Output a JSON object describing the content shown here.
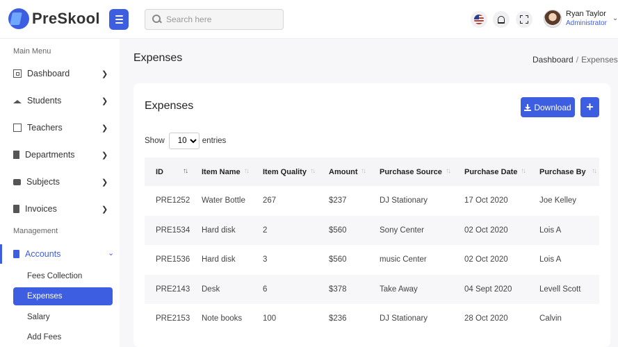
{
  "brand": {
    "name": "PreSkool"
  },
  "search": {
    "placeholder": "Search here"
  },
  "user": {
    "name": "Ryan Taylor",
    "role": "Administrator"
  },
  "sidebar": {
    "main_title": "Main Menu",
    "main_items": [
      {
        "label": "Dashboard",
        "icon": "dashboard-icon"
      },
      {
        "label": "Students",
        "icon": "graduation-cap-icon"
      },
      {
        "label": "Teachers",
        "icon": "teacher-board-icon"
      },
      {
        "label": "Departments",
        "icon": "building-icon"
      },
      {
        "label": "Subjects",
        "icon": "book-icon"
      },
      {
        "label": "Invoices",
        "icon": "clipboard-icon"
      }
    ],
    "management_title": "Management",
    "accounts": {
      "label": "Accounts",
      "icon": "file-invoice-icon"
    },
    "accounts_sub": [
      "Fees Collection",
      "Expenses",
      "Salary",
      "Add Fees"
    ]
  },
  "page": {
    "title": "Expenses",
    "breadcrumb": [
      "Dashboard",
      "Expenses"
    ]
  },
  "card": {
    "title": "Expenses",
    "download_label": "Download",
    "add_label": "+",
    "show_label": "Show",
    "entries_value": "10",
    "entries_label": "entries"
  },
  "table": {
    "columns": [
      "ID",
      "Item Name",
      "Item Quality",
      "Amount",
      "Purchase Source",
      "Purchase Date",
      "Purchase By"
    ],
    "rows": [
      [
        "PRE1252",
        "Water Bottle",
        "267",
        "$237",
        "DJ Stationary",
        "17 Oct 2020",
        "Joe Kelley"
      ],
      [
        "PRE1534",
        "Hard disk",
        "2",
        "$560",
        "Sony Center",
        "02 Oct 2020",
        "Lois A"
      ],
      [
        "PRE1536",
        "Hard disk",
        "3",
        "$560",
        "music Center",
        "02 Oct 2020",
        "Lois A"
      ],
      [
        "PRE2143",
        "Desk",
        "6",
        "$378",
        "Take Away",
        "04 Sept 2020",
        "Levell Scott"
      ],
      [
        "PRE2153",
        "Note books",
        "100",
        "$236",
        "DJ Stationary",
        "28 Oct 2020",
        "Calvin"
      ]
    ]
  },
  "colors": {
    "primary": "#3d5ee1",
    "background": "#f7f7fa"
  }
}
